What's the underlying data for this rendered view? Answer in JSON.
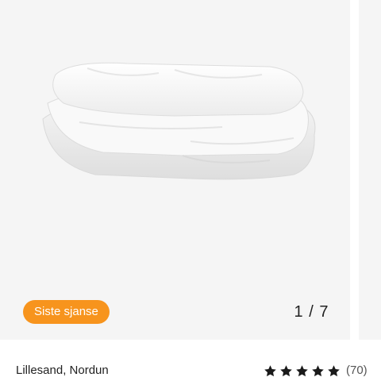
{
  "carousel": {
    "badge_label": "Siste sjanse",
    "page_counter": "1 / 7",
    "current_page": 1,
    "total_pages": 7
  },
  "product": {
    "image_subject": "white folded duvet",
    "title": "Lillesand, Nordun",
    "rating": {
      "stars_filled": 5,
      "stars_total": 5,
      "icon": "star-icon",
      "color": "#1a1a1a",
      "review_count_label": "(70)"
    }
  },
  "colors": {
    "badge_bg": "#f7941d",
    "carousel_bg": "#f5f5f5"
  }
}
